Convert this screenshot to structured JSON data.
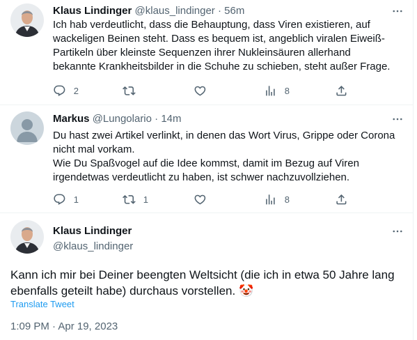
{
  "tweets": [
    {
      "name": "Klaus Lindinger",
      "handle": "@klaus_lindinger",
      "sep": "·",
      "time": "56m",
      "lines": [
        "Ich hab verdeutlicht, dass die Behauptung, dass Viren existieren, auf",
        "wackeligen Beinen steht. Dass es bequem ist, angeblich viralen Eiweiß-",
        "Partikeln über kleinste Sequenzen ihrer Nukleinsäuren allerhand",
        "bekannte Krankheitsbilder in die Schuhe zu schieben, steht außer Frage."
      ],
      "replies": "2",
      "retweets": "",
      "likes": "",
      "views": "8"
    },
    {
      "name": "Markus",
      "handle": "@Lungolario",
      "sep": "·",
      "time": "14m",
      "lines": [
        "Du hast zwei Artikel verlinkt, in denen das Wort Virus, Grippe oder Corona",
        "nicht mal vorkam.",
        "Wie Du Spaßvogel auf die Idee kommst, damit im Bezug auf Viren",
        "irgendetwas verdeutlicht zu haben, ist schwer nachzuvollziehen."
      ],
      "replies": "1",
      "retweets": "1",
      "likes": "",
      "views": "8"
    }
  ],
  "main": {
    "name": "Klaus Lindinger",
    "handle": "@klaus_lindinger",
    "lines": [
      "Kann ich mir bei Deiner beengten Weltsicht (die ich in etwa 50 Jahre lang",
      "ebenfalls geteilt habe) durchaus vorstellen."
    ],
    "emoji": "🤡",
    "translate": "Translate Tweet",
    "timestamp": "1:09 PM · Apr 19, 2023"
  },
  "colors": {
    "text": "#0f1419",
    "muted": "#536471",
    "link": "#1d9bf0",
    "divider": "#eff3f4"
  },
  "icons": [
    "more-icon",
    "reply-icon",
    "retweet-icon",
    "like-icon",
    "views-icon",
    "share-icon",
    "default-avatar-icon"
  ]
}
